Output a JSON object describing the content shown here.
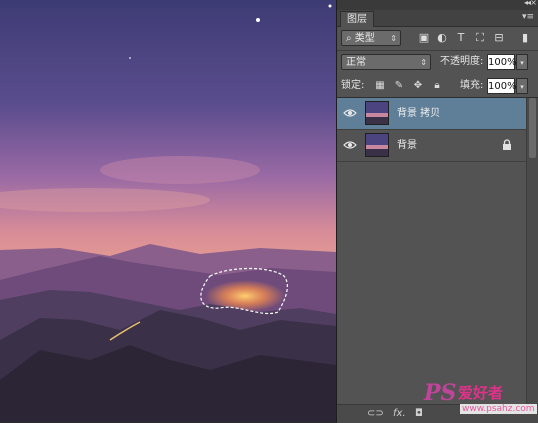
{
  "panel": {
    "tab_label": "图层",
    "filter": {
      "kind_label": "类型"
    },
    "blend": {
      "mode": "正常",
      "opacity_label": "不透明度:",
      "opacity_value": "100%"
    },
    "lock": {
      "label": "锁定:",
      "fill_label": "填充:",
      "fill_value": "100%"
    },
    "layers": [
      {
        "name": "背景 拷贝",
        "selected": true,
        "visible": true,
        "locked": false
      },
      {
        "name": "背景",
        "selected": false,
        "visible": true,
        "locked": true
      }
    ],
    "bottom_icons": [
      "link-icon",
      "fx-icon",
      "mask-icon"
    ],
    "fx_label": "fx."
  },
  "colors": {
    "selected_layer": "#5f7f98",
    "panel_bg": "#535353"
  },
  "watermark": {
    "logo": "PS",
    "brand": "爱好者",
    "url": "www.psahz.com"
  }
}
